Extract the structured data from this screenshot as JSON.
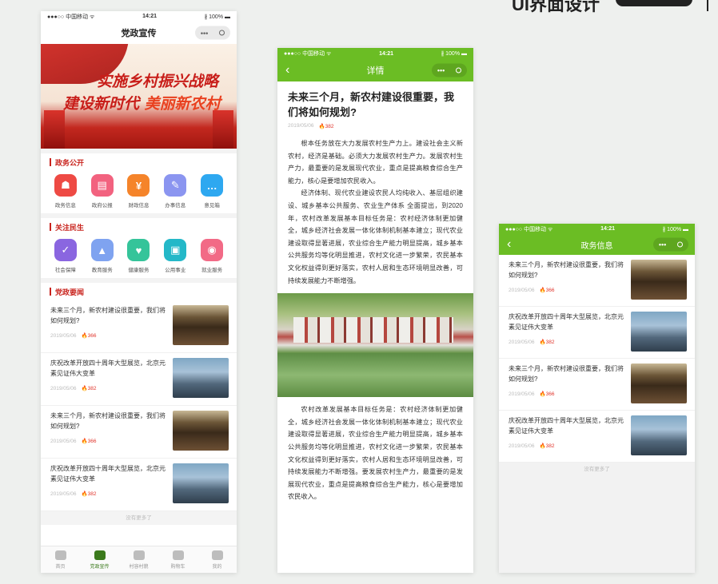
{
  "header_deco": {
    "title": "UI界面设计"
  },
  "phone1": {
    "status": {
      "carrier": "●●●○○ 中国移动 ᯤ",
      "time": "14:21",
      "battery": "∦ 100% ▬"
    },
    "nav_title": "党政宣传",
    "banner": {
      "line1": "实施乡村振兴战略",
      "line2a": "建设新时代 ",
      "line2b": "美丽新农村"
    },
    "sections": [
      {
        "title": "政务公开",
        "items": [
          {
            "label": "政务信息",
            "glyph": "☗",
            "color": "#ee4a44"
          },
          {
            "label": "政府公报",
            "glyph": "▤",
            "color": "#f2627f"
          },
          {
            "label": "财政信息",
            "glyph": "¥",
            "color": "#f5842a"
          },
          {
            "label": "办事信息",
            "glyph": "✎",
            "color": "#8b95f0"
          },
          {
            "label": "意见箱",
            "glyph": "…",
            "color": "#2ea8f0"
          }
        ]
      },
      {
        "title": "关注民生",
        "items": [
          {
            "label": "社会保障",
            "glyph": "✓",
            "color": "#8a66e0"
          },
          {
            "label": "教育服务",
            "glyph": "▲",
            "color": "#7fa3f0"
          },
          {
            "label": "健康服务",
            "glyph": "♥",
            "color": "#35c49a"
          },
          {
            "label": "公用事业",
            "glyph": "▣",
            "color": "#24b8c8"
          },
          {
            "label": "就业服务",
            "glyph": "◉",
            "color": "#f26a86"
          }
        ]
      }
    ],
    "news_title": "党政要闻",
    "news": [
      {
        "title": "未来三个月，新农村建设很重要，我们将如何规划?",
        "date": "2019/05/06",
        "views": "366",
        "img": "hall"
      },
      {
        "title": "庆祝改革开放四十周年大型展览，北京元素见证伟大变革",
        "date": "2019/05/06",
        "views": "382",
        "img": "city"
      },
      {
        "title": "未来三个月，新农村建设很重要，我们将如何规划?",
        "date": "2019/05/06",
        "views": "366",
        "img": "hall"
      },
      {
        "title": "庆祝改革开放四十周年大型展览，北京元素见证伟大变革",
        "date": "2019/05/06",
        "views": "382",
        "img": "city"
      }
    ],
    "more": "没有更多了",
    "tabs": [
      {
        "label": "首页"
      },
      {
        "label": "党政宣传"
      },
      {
        "label": "村容村貌"
      },
      {
        "label": "购物车"
      },
      {
        "label": "我的"
      }
    ],
    "active_tab": 1
  },
  "phone2": {
    "status": {
      "carrier": "●●●○○ 中国移动 ᯤ",
      "time": "14:21",
      "battery": "∦ 100% ▬"
    },
    "nav_title": "详情",
    "title": "未来三个月，新农村建设很重要，我们将如何规划?",
    "date": "2019/05/06",
    "views": "382",
    "para1": "根本任务放在大力发展农村生产力上。建设社会主义新农村，经济是基础。必须大力发展农村生产力。发展农村生产力，最重要的是发展现代农业，重点是提高粮食综合生产能力，核心是要增加农民收入。",
    "para2": "经济体制、现代农业建设农民人均纯收入、基层组织建设、城乡基本公共服务、农业生产体系 全面提出，到2020年，农村改革发展基本目标任务是：农村经济体制更加健全，城乡经济社会发展一体化体制机制基本建立；现代农业建设取得显著进展，农业综合生产能力明显提高，城乡基本公共服务均等化明显推进，农村文化进一步繁荣，农民基本文化权益得到更好落实，农村人居和生态环境明显改善，可持续发展能力不断增强。",
    "para3": "农村改革发展基本目标任务是：农村经济体制更加健全，城乡经济社会发展一体化体制机制基本建立；现代农业建设取得显著进展，农业综合生产能力明显提高，城乡基本公共服务均等化明显推进，农村文化进一步繁荣，农民基本文化权益得到更好落实，农村人居和生态环境明显改善，可持续发展能力不断增强。要发展农村生产力，最重要的是发展现代农业，重点是提高粮食综合生产能力，核心是要增加农民收入。"
  },
  "phone3": {
    "status": {
      "carrier": "●●●○○ 中国移动 ᯤ",
      "time": "14:21",
      "battery": "∦ 100% ▬"
    },
    "nav_title": "政务信息",
    "news": [
      {
        "title": "未来三个月，新农村建设很重要，我们将如何规划?",
        "date": "2019/05/06",
        "views": "366",
        "img": "hall"
      },
      {
        "title": "庆祝改革开放四十周年大型展览，北京元素见证伟大变革",
        "date": "2019/05/06",
        "views": "382",
        "img": "city"
      },
      {
        "title": "未来三个月，新农村建设很重要，我们将如何规划?",
        "date": "2019/05/06",
        "views": "366",
        "img": "hall"
      },
      {
        "title": "庆祝改革开放四十周年大型展览，北京元素见证伟大变革",
        "date": "2019/05/06",
        "views": "382",
        "img": "city"
      }
    ],
    "more": "没有更多了"
  }
}
